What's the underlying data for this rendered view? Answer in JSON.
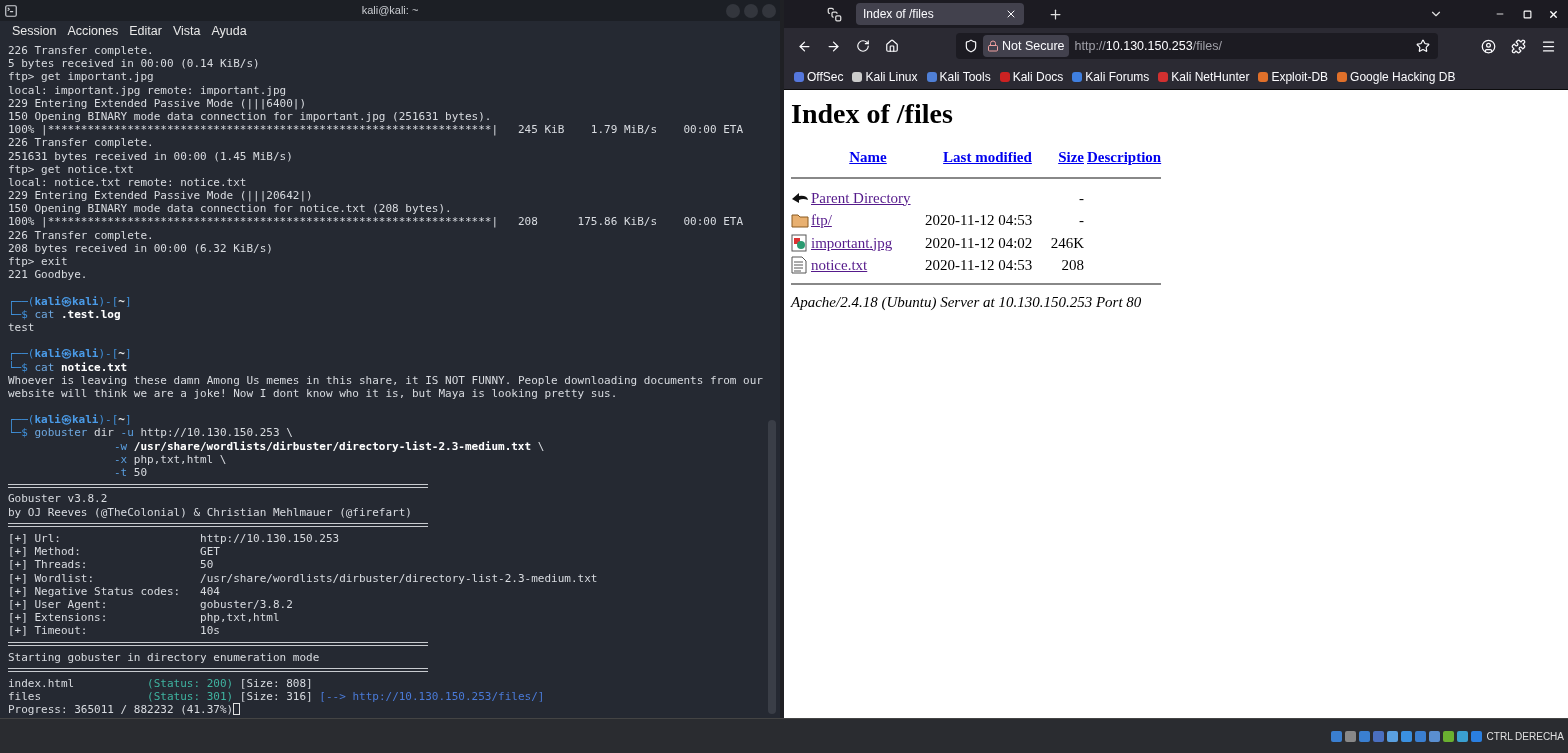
{
  "terminal": {
    "title": "kali@kali: ~",
    "menu": [
      "Session",
      "Acciones",
      "Editar",
      "Vista",
      "Ayuda"
    ],
    "cursor": true,
    "lines": [
      {
        "kind": "text",
        "segments": [
          {
            "kind": "plain",
            "text": "226 Transfer complete."
          }
        ]
      },
      {
        "kind": "text",
        "segments": [
          {
            "kind": "plain",
            "text": "5 bytes received in 00:00 (0.14 KiB/s)"
          }
        ]
      },
      {
        "kind": "text",
        "segments": [
          {
            "kind": "plain",
            "text": "ftp> get important.jpg"
          }
        ]
      },
      {
        "kind": "text",
        "segments": [
          {
            "kind": "plain",
            "text": "local: important.jpg remote: important.jpg"
          }
        ]
      },
      {
        "kind": "text",
        "segments": [
          {
            "kind": "plain",
            "text": "229 Entering Extended Passive Mode (|||6400|)"
          }
        ]
      },
      {
        "kind": "text",
        "segments": [
          {
            "kind": "plain",
            "text": "150 Opening BINARY mode data connection for important.jpg (251631 bytes)."
          }
        ]
      },
      {
        "kind": "text",
        "segments": [
          {
            "kind": "plain",
            "text": "100% |*******************************************************************|   245 KiB    1.79 MiB/s    00:00 ETA"
          }
        ]
      },
      {
        "kind": "text",
        "segments": [
          {
            "kind": "plain",
            "text": "226 Transfer complete."
          }
        ]
      },
      {
        "kind": "text",
        "segments": [
          {
            "kind": "plain",
            "text": "251631 bytes received in 00:00 (1.45 MiB/s)"
          }
        ]
      },
      {
        "kind": "text",
        "segments": [
          {
            "kind": "plain",
            "text": "ftp> get notice.txt"
          }
        ]
      },
      {
        "kind": "text",
        "segments": [
          {
            "kind": "plain",
            "text": "local: notice.txt remote: notice.txt"
          }
        ]
      },
      {
        "kind": "text",
        "segments": [
          {
            "kind": "plain",
            "text": "229 Entering Extended Passive Mode (|||20642|)"
          }
        ]
      },
      {
        "kind": "text",
        "segments": [
          {
            "kind": "plain",
            "text": "150 Opening BINARY mode data connection for notice.txt (208 bytes)."
          }
        ]
      },
      {
        "kind": "text",
        "segments": [
          {
            "kind": "plain",
            "text": "100% |*******************************************************************|   208      175.86 KiB/s    00:00 ETA"
          }
        ]
      },
      {
        "kind": "text",
        "segments": [
          {
            "kind": "plain",
            "text": "226 Transfer complete."
          }
        ]
      },
      {
        "kind": "text",
        "segments": [
          {
            "kind": "plain",
            "text": "208 bytes received in 00:00 (6.32 KiB/s)"
          }
        ]
      },
      {
        "kind": "text",
        "segments": [
          {
            "kind": "plain",
            "text": "ftp> exit"
          }
        ]
      },
      {
        "kind": "text",
        "segments": [
          {
            "kind": "plain",
            "text": "221 Goodbye."
          }
        ]
      },
      {
        "kind": "blank"
      },
      {
        "kind": "text",
        "segments": [
          {
            "kind": "frame",
            "text": "┌──("
          },
          {
            "kind": "userhost",
            "text": "kali㉿kali"
          },
          {
            "kind": "frame",
            "text": ")-["
          },
          {
            "kind": "dir",
            "text": "~"
          },
          {
            "kind": "frame",
            "text": "]"
          }
        ]
      },
      {
        "kind": "text",
        "segments": [
          {
            "kind": "frame",
            "text": "└─$"
          },
          {
            "kind": "cmd",
            "text": " cat"
          },
          {
            "kind": "bold",
            "text": " .test.log"
          }
        ]
      },
      {
        "kind": "text",
        "segments": [
          {
            "kind": "plain",
            "text": "test"
          }
        ]
      },
      {
        "kind": "blank"
      },
      {
        "kind": "text",
        "segments": [
          {
            "kind": "frame",
            "text": "┌──("
          },
          {
            "kind": "userhost",
            "text": "kali㉿kali"
          },
          {
            "kind": "frame",
            "text": ")-["
          },
          {
            "kind": "dir",
            "text": "~"
          },
          {
            "kind": "frame",
            "text": "]"
          }
        ]
      },
      {
        "kind": "text",
        "segments": [
          {
            "kind": "frame",
            "text": "└─$"
          },
          {
            "kind": "cmd",
            "text": " cat"
          },
          {
            "kind": "bold",
            "text": " notice.txt"
          }
        ]
      },
      {
        "kind": "text",
        "segments": [
          {
            "kind": "plain",
            "text": "Whoever is leaving these damn Among Us memes in this share, it IS NOT FUNNY. People downloading documents from our"
          }
        ]
      },
      {
        "kind": "text",
        "segments": [
          {
            "kind": "plain",
            "text": "website will think we are a joke! Now I dont know who it is, but Maya is looking pretty sus."
          }
        ]
      },
      {
        "kind": "blank"
      },
      {
        "kind": "text",
        "segments": [
          {
            "kind": "frame",
            "text": "┌──("
          },
          {
            "kind": "userhost",
            "text": "kali㉿kali"
          },
          {
            "kind": "frame",
            "text": ")-["
          },
          {
            "kind": "dir",
            "text": "~"
          },
          {
            "kind": "frame",
            "text": "]"
          }
        ]
      },
      {
        "kind": "text",
        "segments": [
          {
            "kind": "frame",
            "text": "└─$"
          },
          {
            "kind": "cmd",
            "text": " gobuster"
          },
          {
            "kind": "plain",
            "text": " dir"
          },
          {
            "kind": "flag",
            "text": " -u"
          },
          {
            "kind": "plain",
            "text": " http://10.130.150.253 \\"
          }
        ]
      },
      {
        "kind": "continuation",
        "segments": [
          {
            "kind": "flag",
            "text": "-w"
          },
          {
            "kind": "bold",
            "text": " /usr/share/wordlists/dirbuster/directory-list-2.3-medium.txt"
          },
          {
            "kind": "plain",
            "text": " \\"
          }
        ]
      },
      {
        "kind": "continuation",
        "segments": [
          {
            "kind": "flag",
            "text": "-x"
          },
          {
            "kind": "plain",
            "text": " php,txt,html \\"
          }
        ]
      },
      {
        "kind": "continuation",
        "segments": [
          {
            "kind": "flag",
            "text": "-t"
          },
          {
            "kind": "plain",
            "text": " 50"
          }
        ]
      },
      {
        "kind": "rule"
      },
      {
        "kind": "text",
        "segments": [
          {
            "kind": "plain",
            "text": "Gobuster v3.8.2"
          }
        ]
      },
      {
        "kind": "text",
        "segments": [
          {
            "kind": "plain",
            "text": "by OJ Reeves (@TheColonial) & Christian Mehlmauer (@firefart)"
          }
        ]
      },
      {
        "kind": "rule"
      },
      {
        "kind": "text",
        "segments": [
          {
            "kind": "plain",
            "text": "[+] Url:                     http://10.130.150.253"
          }
        ]
      },
      {
        "kind": "text",
        "segments": [
          {
            "kind": "plain",
            "text": "[+] Method:                  GET"
          }
        ]
      },
      {
        "kind": "text",
        "segments": [
          {
            "kind": "plain",
            "text": "[+] Threads:                 50"
          }
        ]
      },
      {
        "kind": "text",
        "segments": [
          {
            "kind": "plain",
            "text": "[+] Wordlist:                /usr/share/wordlists/dirbuster/directory-list-2.3-medium.txt"
          }
        ]
      },
      {
        "kind": "text",
        "segments": [
          {
            "kind": "plain",
            "text": "[+] Negative Status codes:   404"
          }
        ]
      },
      {
        "kind": "text",
        "segments": [
          {
            "kind": "plain",
            "text": "[+] User Agent:              gobuster/3.8.2"
          }
        ]
      },
      {
        "kind": "text",
        "segments": [
          {
            "kind": "plain",
            "text": "[+] Extensions:              php,txt,html"
          }
        ]
      },
      {
        "kind": "text",
        "segments": [
          {
            "kind": "plain",
            "text": "[+] Timeout:                 10s"
          }
        ]
      },
      {
        "kind": "rule"
      },
      {
        "kind": "text",
        "segments": [
          {
            "kind": "plain",
            "text": "Starting gobuster in directory enumeration mode"
          }
        ]
      },
      {
        "kind": "rule"
      },
      {
        "kind": "text",
        "segments": [
          {
            "kind": "plain",
            "text": "index.html           "
          },
          {
            "kind": "status",
            "text": "(Status: 200)"
          },
          {
            "kind": "plain",
            "text": " [Size: 808]"
          }
        ]
      },
      {
        "kind": "text",
        "segments": [
          {
            "kind": "plain",
            "text": "files                "
          },
          {
            "kind": "status",
            "text": "(Status: 301)"
          },
          {
            "kind": "plain",
            "text": " [Size: 316]"
          },
          {
            "kind": "link",
            "text": " [--> http://10.130.150.253/files/]"
          }
        ]
      },
      {
        "kind": "text",
        "segments": [
          {
            "kind": "plain",
            "text": "Progress: 365011 / 882232 (41.37%)"
          }
        ]
      }
    ]
  },
  "browser": {
    "tab": {
      "title": "Index of /files",
      "selected": true
    },
    "address": {
      "security": "Not Secure",
      "scheme": "http://",
      "host": "10.130.150.253",
      "path": "/files/"
    },
    "bookmarks": [
      {
        "label": "OffSec",
        "color": "#5577dd"
      },
      {
        "label": "Kali Linux",
        "color": "#cccccc"
      },
      {
        "label": "Kali Tools",
        "color": "#4f7fd6"
      },
      {
        "label": "Kali Docs",
        "color": "#cc2222"
      },
      {
        "label": "Kali Forums",
        "color": "#3f7fe0"
      },
      {
        "label": "Kali NetHunter",
        "color": "#d23030"
      },
      {
        "label": "Exploit-DB",
        "color": "#e0702a"
      },
      {
        "label": "Google Hacking DB",
        "color": "#e0702a"
      }
    ],
    "page": {
      "heading": "Index of /files",
      "columns": [
        "Name",
        "Last modified",
        "Size",
        "Description"
      ],
      "rows": [
        {
          "kind": "parent",
          "name": "Parent Directory",
          "size": "-"
        },
        {
          "kind": "folder",
          "name": "ftp/",
          "modified": "2020-11-12 04:53",
          "size": "-"
        },
        {
          "kind": "image",
          "name": "important.jpg",
          "modified": "2020-11-12 04:02",
          "size": "246K"
        },
        {
          "kind": "text",
          "name": "notice.txt",
          "modified": "2020-11-12 04:53",
          "size": "208"
        }
      ],
      "footer": "Apache/2.4.18 (Ubuntu) Server at 10.130.150.253 Port 80"
    }
  },
  "taskbar": {
    "keyboard_hint": "CTRL DERECHA"
  }
}
